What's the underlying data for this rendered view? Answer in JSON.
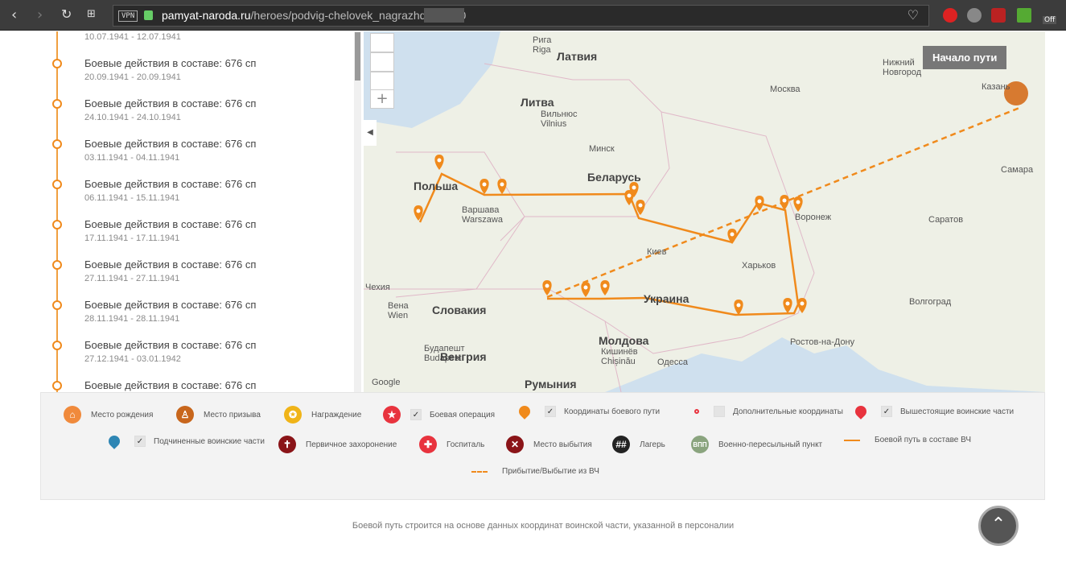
{
  "browser": {
    "url_domain": "pamyat-naroda.ru",
    "url_path": "/heroes/podvig-chelovek_nagrazhdenie340",
    "vpn": "VPN",
    "ext_badge": "Off"
  },
  "timeline": [
    {
      "label": "",
      "date": "10.07.1941 - 12.07.1941"
    },
    {
      "label": "Боевые действия в составе: 676 сп",
      "date": "20.09.1941 - 20.09.1941"
    },
    {
      "label": "Боевые действия в составе: 676 сп",
      "date": "24.10.1941 - 24.10.1941"
    },
    {
      "label": "Боевые действия в составе: 676 сп",
      "date": "03.11.1941 - 04.11.1941"
    },
    {
      "label": "Боевые действия в составе: 676 сп",
      "date": "06.11.1941 - 15.11.1941"
    },
    {
      "label": "Боевые действия в составе: 676 сп",
      "date": "17.11.1941 - 17.11.1941"
    },
    {
      "label": "Боевые действия в составе: 676 сп",
      "date": "27.11.1941 - 27.11.1941"
    },
    {
      "label": "Боевые действия в составе: 676 сп",
      "date": "28.11.1941 - 28.11.1941"
    },
    {
      "label": "Боевые действия в составе: 676 сп",
      "date": "27.12.1941 - 03.01.1942"
    },
    {
      "label": "Боевые действия в составе: 676 сп",
      "date": ""
    }
  ],
  "map": {
    "tooltip": "Начало пути",
    "zoom_in": "+",
    "labels": {
      "riga": "Рига\nRiga",
      "latvia": "Латвия",
      "lithuania": "Литва",
      "vilnius": "Вильнюс\nVilnius",
      "minsk": "Минск",
      "belarus": "Беларусь",
      "poland": "Польша",
      "warsaw": "Варшава\nWarszawa",
      "kiev": "Киев",
      "kharkov": "Харьков",
      "voronezh": "Воронеж",
      "ukraine": "Украина",
      "moscow": "Москва",
      "nnovgorod": "Нижний\nНовгород",
      "kazan": "Казань",
      "samara": "Самара",
      "saratov": "Саратов",
      "volgograd": "Волгоград",
      "rostov": "Ростов-на-Дону",
      "odessa": "Одесса",
      "kishinev": "Кишинёв\nChișinău",
      "moldova": "Молдова",
      "romania": "Румыния",
      "czech": "Чехия",
      "slovakia": "Словакия",
      "vienna": "Вена\nWien",
      "budapest": "Будапешт\nBudapest",
      "hungary": "Венгрия",
      "google": "Google"
    },
    "colors": {
      "route": "#f08a1c"
    }
  },
  "legend": {
    "items": [
      {
        "label": "Место рождения",
        "color": "#f08a3c"
      },
      {
        "label": "Место призыва",
        "color": "#c8661c"
      },
      {
        "label": "Награждение",
        "color": "#f0b418"
      },
      {
        "label": "Боевая операция",
        "color": "#e8333e"
      },
      {
        "label": "Координаты боевого пути",
        "color": "#f08a1c"
      },
      {
        "label": "Дополнительные координаты",
        "color": "#e8333e"
      },
      {
        "label": "Вышестоящие воинские части",
        "color": "#e8333e"
      },
      {
        "label": "Подчиненные воинские части",
        "color": "#2e86b4"
      },
      {
        "label": "Первичное захоронение",
        "color": "#8a1418"
      },
      {
        "label": "Госпиталь",
        "color": "#e8333e"
      },
      {
        "label": "Место выбытия",
        "color": "#8a1418"
      },
      {
        "label": "Лагерь",
        "color": "#222222"
      },
      {
        "label": "Военно-пересыльный пункт",
        "color": "#8aa47e",
        "badge": "ВПП"
      },
      {
        "label": "Боевой путь в составе ВЧ",
        "color": "#f08a1c"
      },
      {
        "label": "Прибытие/Выбытие из ВЧ",
        "color": "#f08a1c"
      }
    ],
    "check": "✓"
  },
  "footer": "Боевой путь строится на основе данных координат воинской части, указанной в персоналии"
}
